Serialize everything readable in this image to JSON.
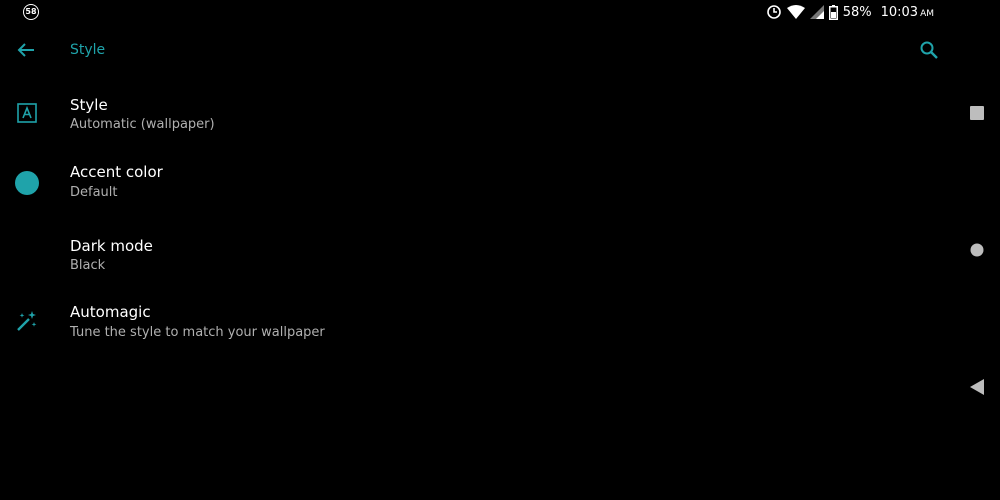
{
  "status_bar": {
    "notification_count": "58",
    "battery_percent": "58%",
    "time": "10:03",
    "ampm": "AM"
  },
  "toolbar": {
    "title": "Style"
  },
  "settings": {
    "items": [
      {
        "title": "Style",
        "subtitle": "Automatic (wallpaper)",
        "icon": "style-a-icon"
      },
      {
        "title": "Accent color",
        "subtitle": "Default",
        "icon": "accent-dot-icon"
      },
      {
        "title": "Dark mode",
        "subtitle": "Black",
        "icon": ""
      },
      {
        "title": "Automagic",
        "subtitle": "Tune the style to match your wallpaper",
        "icon": "magic-wand-icon"
      }
    ]
  },
  "colors": {
    "accent": "#1fa3aa",
    "background": "#000000",
    "text_primary": "#ffffff",
    "text_secondary": "#b0b0b0"
  }
}
